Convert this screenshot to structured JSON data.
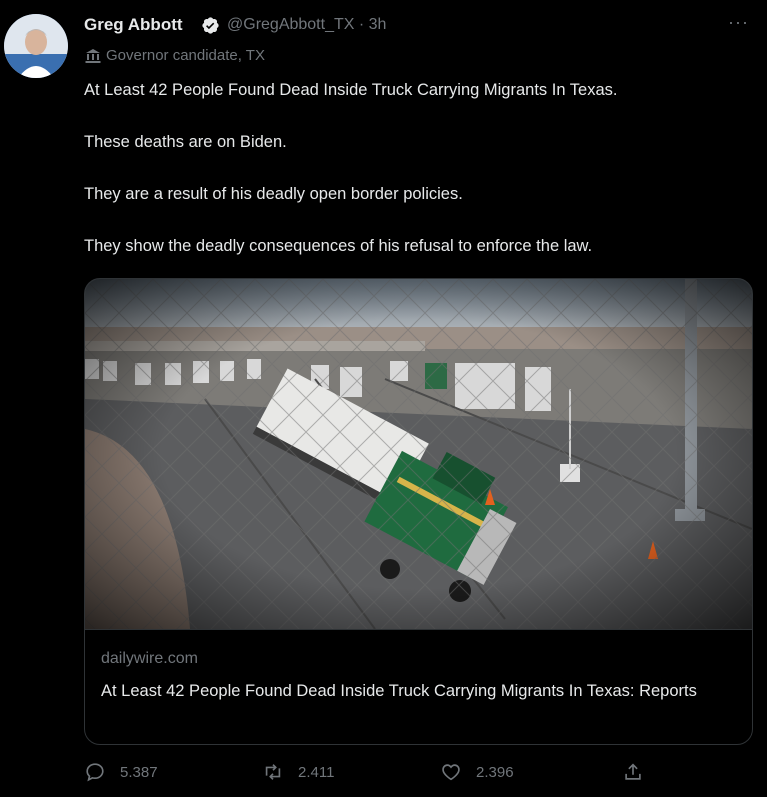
{
  "tweet": {
    "author_name": "Greg Abbott",
    "handle_time": "@GregAbbott_TX · 3h",
    "more_label": "···",
    "account_label": "Governor candidate, TX",
    "lines": [
      "At Least 42 People Found Dead Inside Truck Carrying Migrants In Texas.",
      "These deaths are on Biden.",
      "They are a result of his deadly open border policies.",
      "They show the deadly consequences of his refusal to enforce the law."
    ]
  },
  "card": {
    "domain": "dailywire.com",
    "title": "At Least 42 People Found Dead Inside Truck Carrying Migrants In Texas: Reports"
  },
  "actions": {
    "reply_count": "5.387",
    "retweet_count": "2.411",
    "like_count": "2.396"
  },
  "colors": {
    "background": "#000000",
    "text": "#e7e9ea",
    "muted": "#71767b",
    "verified": "#1d9bf0",
    "border": "#2f3336",
    "truck_cab": "#1f6b3f"
  },
  "icons": [
    "verified-badge-icon",
    "government-building-icon",
    "more-icon",
    "reply-icon",
    "retweet-icon",
    "like-icon",
    "share-icon"
  ]
}
